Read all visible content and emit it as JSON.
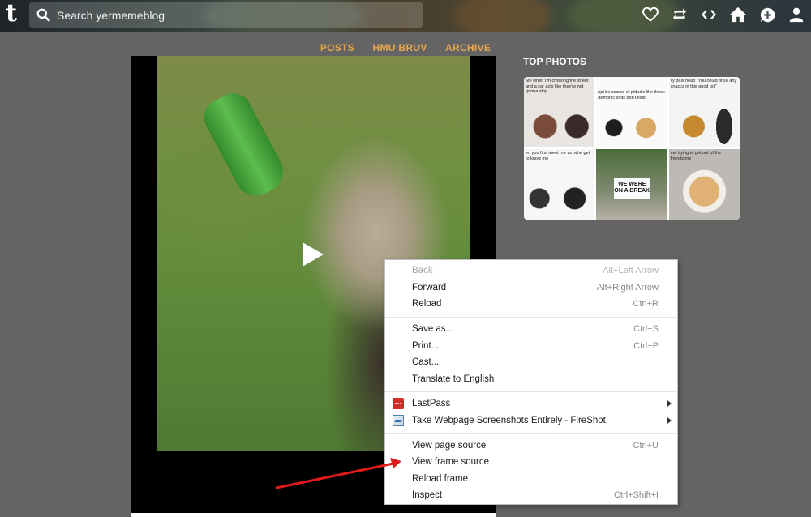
{
  "header": {
    "logo_letter": "t",
    "search_placeholder": "Search yermemeblog",
    "icons": [
      "heart-icon",
      "reblog-icon",
      "code-icon",
      "home-icon",
      "messaging-icon",
      "account-icon"
    ]
  },
  "blog_nav": {
    "items": [
      "POSTS",
      "HMU BRUV",
      "ARCHIVE"
    ],
    "color": "#e8a54b"
  },
  "sidebar": {
    "title": "TOP PHOTOS",
    "thumbs": [
      {
        "caption": "Me when I'm crossing the street and a car acts like they're not gonna stop"
      },
      {
        "caption": "ppl be scared of pitbulls like these demonic shits don't exist"
      },
      {
        "caption": "lly pals head \"You could fit so any snaccs in this good boi\""
      },
      {
        "caption": "en you first meet me vs. whe get to know me"
      },
      {
        "caption": "WE WERE ON A BREAK"
      },
      {
        "caption": "me trying to get out of the friendzone"
      }
    ]
  },
  "context_menu": {
    "groups": [
      [
        {
          "label": "Back",
          "shortcut": "Alt+Left Arrow",
          "disabled": true
        },
        {
          "label": "Forward",
          "shortcut": "Alt+Right Arrow",
          "disabled": false
        },
        {
          "label": "Reload",
          "shortcut": "Ctrl+R",
          "disabled": false
        }
      ],
      [
        {
          "label": "Save as...",
          "shortcut": "Ctrl+S",
          "disabled": false
        },
        {
          "label": "Print...",
          "shortcut": "Ctrl+P",
          "disabled": false
        },
        {
          "label": "Cast...",
          "shortcut": "",
          "disabled": false
        },
        {
          "label": "Translate to English",
          "shortcut": "",
          "disabled": false
        }
      ],
      [
        {
          "label": "LastPass",
          "shortcut": "",
          "submenu": true,
          "icon": "lastpass-icon"
        },
        {
          "label": "Take Webpage Screenshots Entirely - FireShot",
          "shortcut": "",
          "submenu": true,
          "icon": "fireshot-icon"
        }
      ],
      [
        {
          "label": "View page source",
          "shortcut": "Ctrl+U",
          "disabled": false
        },
        {
          "label": "View frame source",
          "shortcut": "",
          "disabled": false
        },
        {
          "label": "Reload frame",
          "shortcut": "",
          "disabled": false
        },
        {
          "label": "Inspect",
          "shortcut": "Ctrl+Shift+I",
          "disabled": false
        }
      ]
    ]
  },
  "colors": {
    "page_background": "#646464",
    "annotation_arrow": "#e01b1b"
  }
}
